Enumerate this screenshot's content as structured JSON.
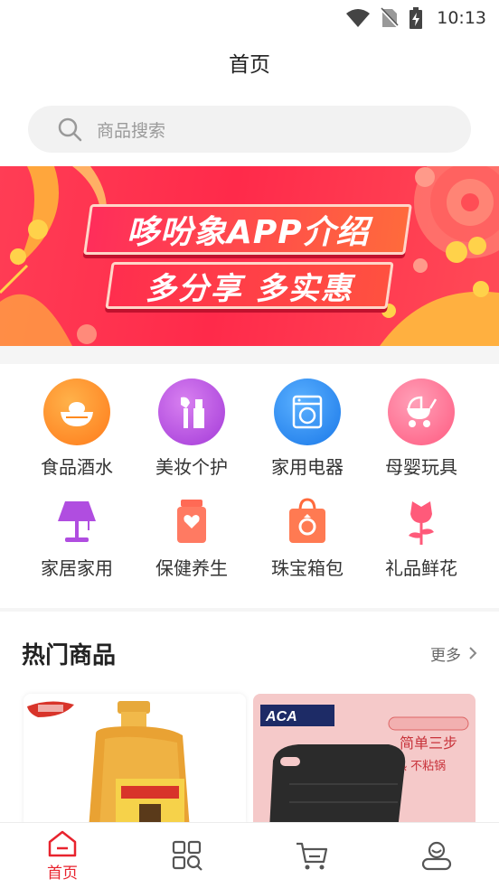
{
  "status_bar": {
    "time": "10:13"
  },
  "nav": {
    "title": "首页"
  },
  "search": {
    "placeholder": "商品搜索"
  },
  "banner": {
    "title": "哆吩象APP介绍",
    "subtitle": "多分享 多实惠"
  },
  "categories": [
    {
      "label": "食品酒水",
      "icon": "food-bowl-icon",
      "color": "#ff8a1f"
    },
    {
      "label": "美妆个护",
      "icon": "makeup-icon",
      "color": "#b046e0"
    },
    {
      "label": "家用电器",
      "icon": "washing-machine-icon",
      "color": "#1f86f0"
    },
    {
      "label": "母婴玩具",
      "icon": "baby-stroller-icon",
      "color": "#ff6a8a"
    },
    {
      "label": "家居家用",
      "icon": "lamp-icon",
      "color": "#b04de0"
    },
    {
      "label": "保健养生",
      "icon": "health-jar-icon",
      "color": "#ff6a55"
    },
    {
      "label": "珠宝箱包",
      "icon": "jewelry-bag-icon",
      "color": "#ff6a3c"
    },
    {
      "label": "礼品鲜花",
      "icon": "flower-icon",
      "color": "#ff5a7a"
    }
  ],
  "hot_products": {
    "title": "热门商品",
    "more_label": "更多",
    "items": [
      {
        "name": "cooking-oil",
        "brand_text": ""
      },
      {
        "name": "sandwich-maker",
        "brand_text": "ACA",
        "slogan": "简单三步",
        "slogan2": "双面加热 不粘锅"
      }
    ]
  },
  "tabs": [
    {
      "label": "首页",
      "icon": "home-icon",
      "active": true
    },
    {
      "label": "",
      "icon": "category-search-icon",
      "active": false
    },
    {
      "label": "",
      "icon": "cart-icon",
      "active": false
    },
    {
      "label": "",
      "icon": "user-icon",
      "active": false
    }
  ],
  "colors": {
    "accent": "#e8232e",
    "banner": "#ff2e4e",
    "search_bg": "#f2f2f2"
  }
}
